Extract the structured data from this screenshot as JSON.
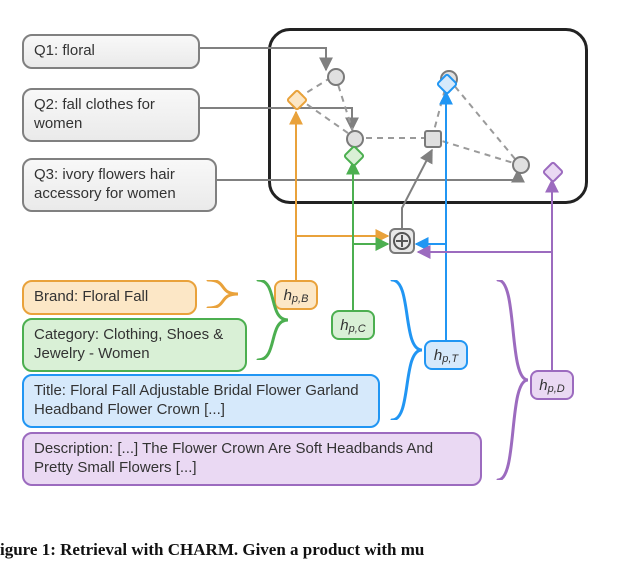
{
  "queries": {
    "q1": {
      "label": "Q1:",
      "text": "floral"
    },
    "q2": {
      "label": "Q2:",
      "text": "fall clothes for women"
    },
    "q3": {
      "label": "Q3:",
      "text": "ivory flowers hair accessory for women"
    }
  },
  "fields": {
    "brand": {
      "label": "Brand:",
      "value": "Floral Fall",
      "color": "#e9a23b",
      "fill": "#fce7c6"
    },
    "category": {
      "label": "Category:",
      "value": "Clothing, Shoes & Jewelry - Women",
      "color": "#4caf50",
      "fill": "#d9f0d6"
    },
    "title": {
      "label": "Title:",
      "value": "Floral Fall Adjustable Bridal Flower Garland Headband Flower Crown [...]",
      "color": "#2196f3",
      "fill": "#d6e9fb"
    },
    "description": {
      "label": "Description:",
      "value": "[...] The Flower Crown Are Soft Headbands And Pretty Small Flowers [...]",
      "color": "#9c6bbf",
      "fill": "#ead9f3"
    }
  },
  "embeddings": {
    "brand": {
      "prefix": "h",
      "sub": "p,B",
      "color": "#e9a23b",
      "fill": "#fce7c6"
    },
    "category": {
      "prefix": "h",
      "sub": "p,C",
      "color": "#4caf50",
      "fill": "#d9f0d6"
    },
    "title": {
      "prefix": "h",
      "sub": "p,T",
      "color": "#2196f3",
      "fill": "#d6e9fb"
    },
    "description": {
      "prefix": "h",
      "sub": "p,D",
      "color": "#9c6bbf",
      "fill": "#ead9f3"
    }
  },
  "caption": "igure 1: Retrieval with CHARM. Given a product with mu",
  "chart_data": {
    "type": "diagram",
    "title": "Retrieval with CHARM",
    "description": "Figure shows three queries (Q1–Q3) on the left entering a latent space (rounded black box). Four product fields (Brand, Category, Title, Description) each produce an embedding h_{p,B}, h_{p,C}, h_{p,T}, h_{p,D}. These are combined (⊕ node) and sent into the latent space where grey circle/square nodes form a dashed connectivity graph. Colored diamond markers in the latent box correspond to field embeddings.",
    "queries": [
      "floral",
      "fall clothes for women",
      "ivory flowers hair accessory for women"
    ],
    "product_fields": {
      "Brand": "Floral Fall",
      "Category": "Clothing, Shoes & Jewelry - Women",
      "Title": "Floral Fall Adjustable Bridal Flower Garland Headband Flower Crown [...]",
      "Description": "[...] The Flower Crown Are Soft Headbands And Pretty Small Flowers [...]"
    },
    "embeddings": [
      "h_{p,B}",
      "h_{p,C}",
      "h_{p,T}",
      "h_{p,D}"
    ],
    "combiner": "⊕",
    "colors": {
      "Brand": "#e9a23b",
      "Category": "#4caf50",
      "Title": "#2196f3",
      "Description": "#9c6bbf"
    }
  }
}
